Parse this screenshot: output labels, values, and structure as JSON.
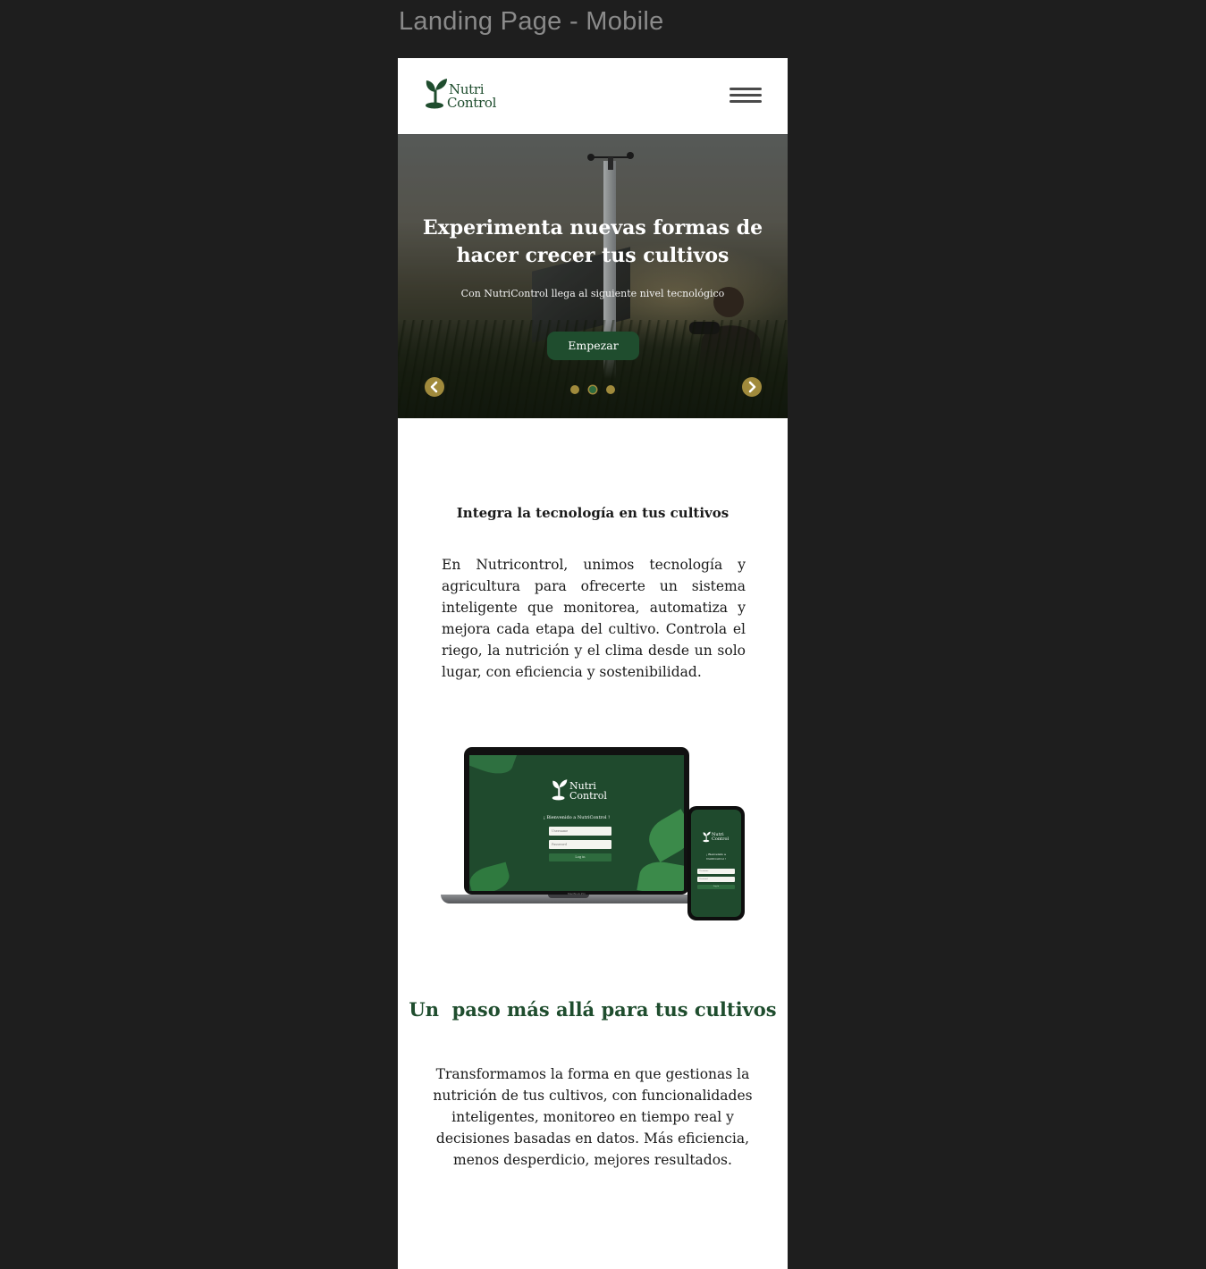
{
  "frame": {
    "title": "Landing Page - Mobile"
  },
  "header": {
    "logo": {
      "line1": "Nutri",
      "line2": "Control"
    },
    "menu_icon": "hamburger-menu-icon"
  },
  "hero": {
    "title_line1": "Experimenta nuevas formas de",
    "title_line2": "hacer crecer tus cultivos",
    "subtitle": "Con NutriControl llega al siguiente nivel tecnológico",
    "cta_label": "Empezar",
    "prev_icon": "chevron-left-icon",
    "next_icon": "chevron-right-icon",
    "slides_count": 3,
    "active_slide": 2
  },
  "section1": {
    "title": "Integra la tecnología en tus cultivos",
    "body": "En Nutricontrol, unimos tecnología y agricultura para ofrecerte un sistema inteligente que monitorea, automatiza y mejora cada etapa del cultivo. Controla el riego, la nutrición y el clima desde un solo lugar, con eficiencia y sostenibilidad."
  },
  "mockup": {
    "laptop": {
      "logo_line1": "Nutri",
      "logo_line2": "Control",
      "welcome": "¡ Bienvenido a NutriControl !",
      "username_placeholder": "Username",
      "password_placeholder": "Password",
      "login_label": "Log in",
      "brand": "MacBook Pro"
    },
    "phone": {
      "logo_line1": "Nutri",
      "logo_line2": "Control",
      "welcome_line1": "¡ Bienvenido a",
      "welcome_line2": "NutriControl !",
      "username_placeholder": "Username",
      "password_placeholder": "Password",
      "login_label": "Log in"
    }
  },
  "section2": {
    "title": "Un  paso más allá para tus cultivos",
    "body": "Transformamos la forma en que gestionas la nutrición de tus cultivos, con funcionalidades inteligentes, monitoreo en tiempo real y decisiones basadas en datos. Más eficiencia, menos desperdicio, mejores resultados."
  },
  "colors": {
    "brand_green": "#1f4d2e",
    "accent_gold": "#a08a3c",
    "canvas_bg": "#1e1e1e"
  }
}
